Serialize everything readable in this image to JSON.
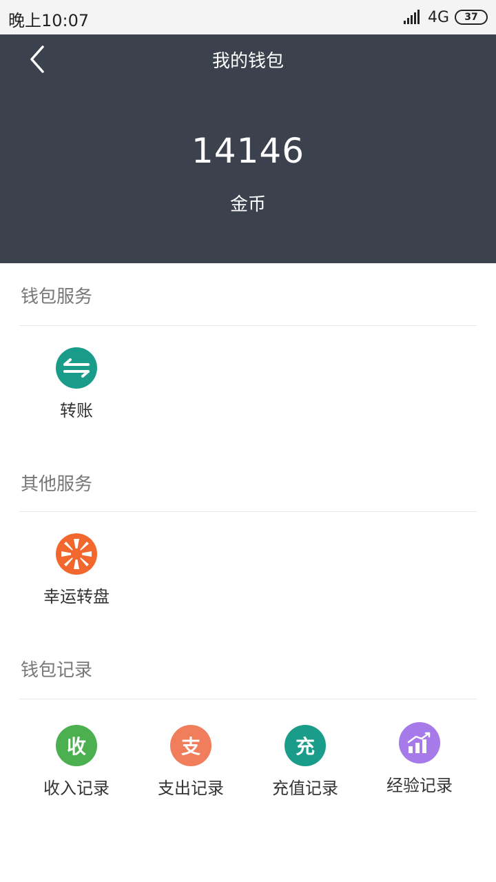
{
  "status_bar": {
    "time": "晚上10:07",
    "network": "4G",
    "battery": "37"
  },
  "header": {
    "title": "我的钱包",
    "balance": "14146",
    "balance_unit": "金币"
  },
  "sections": [
    {
      "title": "钱包服务",
      "items": [
        {
          "label": "转账",
          "icon": "transfer-icon",
          "color": "#1a9c8a"
        }
      ]
    },
    {
      "title": "其他服务",
      "items": [
        {
          "label": "幸运转盘",
          "icon": "lucky-wheel-icon",
          "color": "#f2672e"
        }
      ]
    },
    {
      "title": "钱包记录",
      "items": [
        {
          "label": "收入记录",
          "icon": "income-icon",
          "glyph": "收",
          "color": "#4caf50"
        },
        {
          "label": "支出记录",
          "icon": "expense-icon",
          "glyph": "支",
          "color": "#f07d5b"
        },
        {
          "label": "充值记录",
          "icon": "recharge-icon",
          "glyph": "充",
          "color": "#1a9c8a"
        },
        {
          "label": "经验记录",
          "icon": "experience-chart-icon",
          "color": "#a67ae8"
        }
      ]
    }
  ]
}
